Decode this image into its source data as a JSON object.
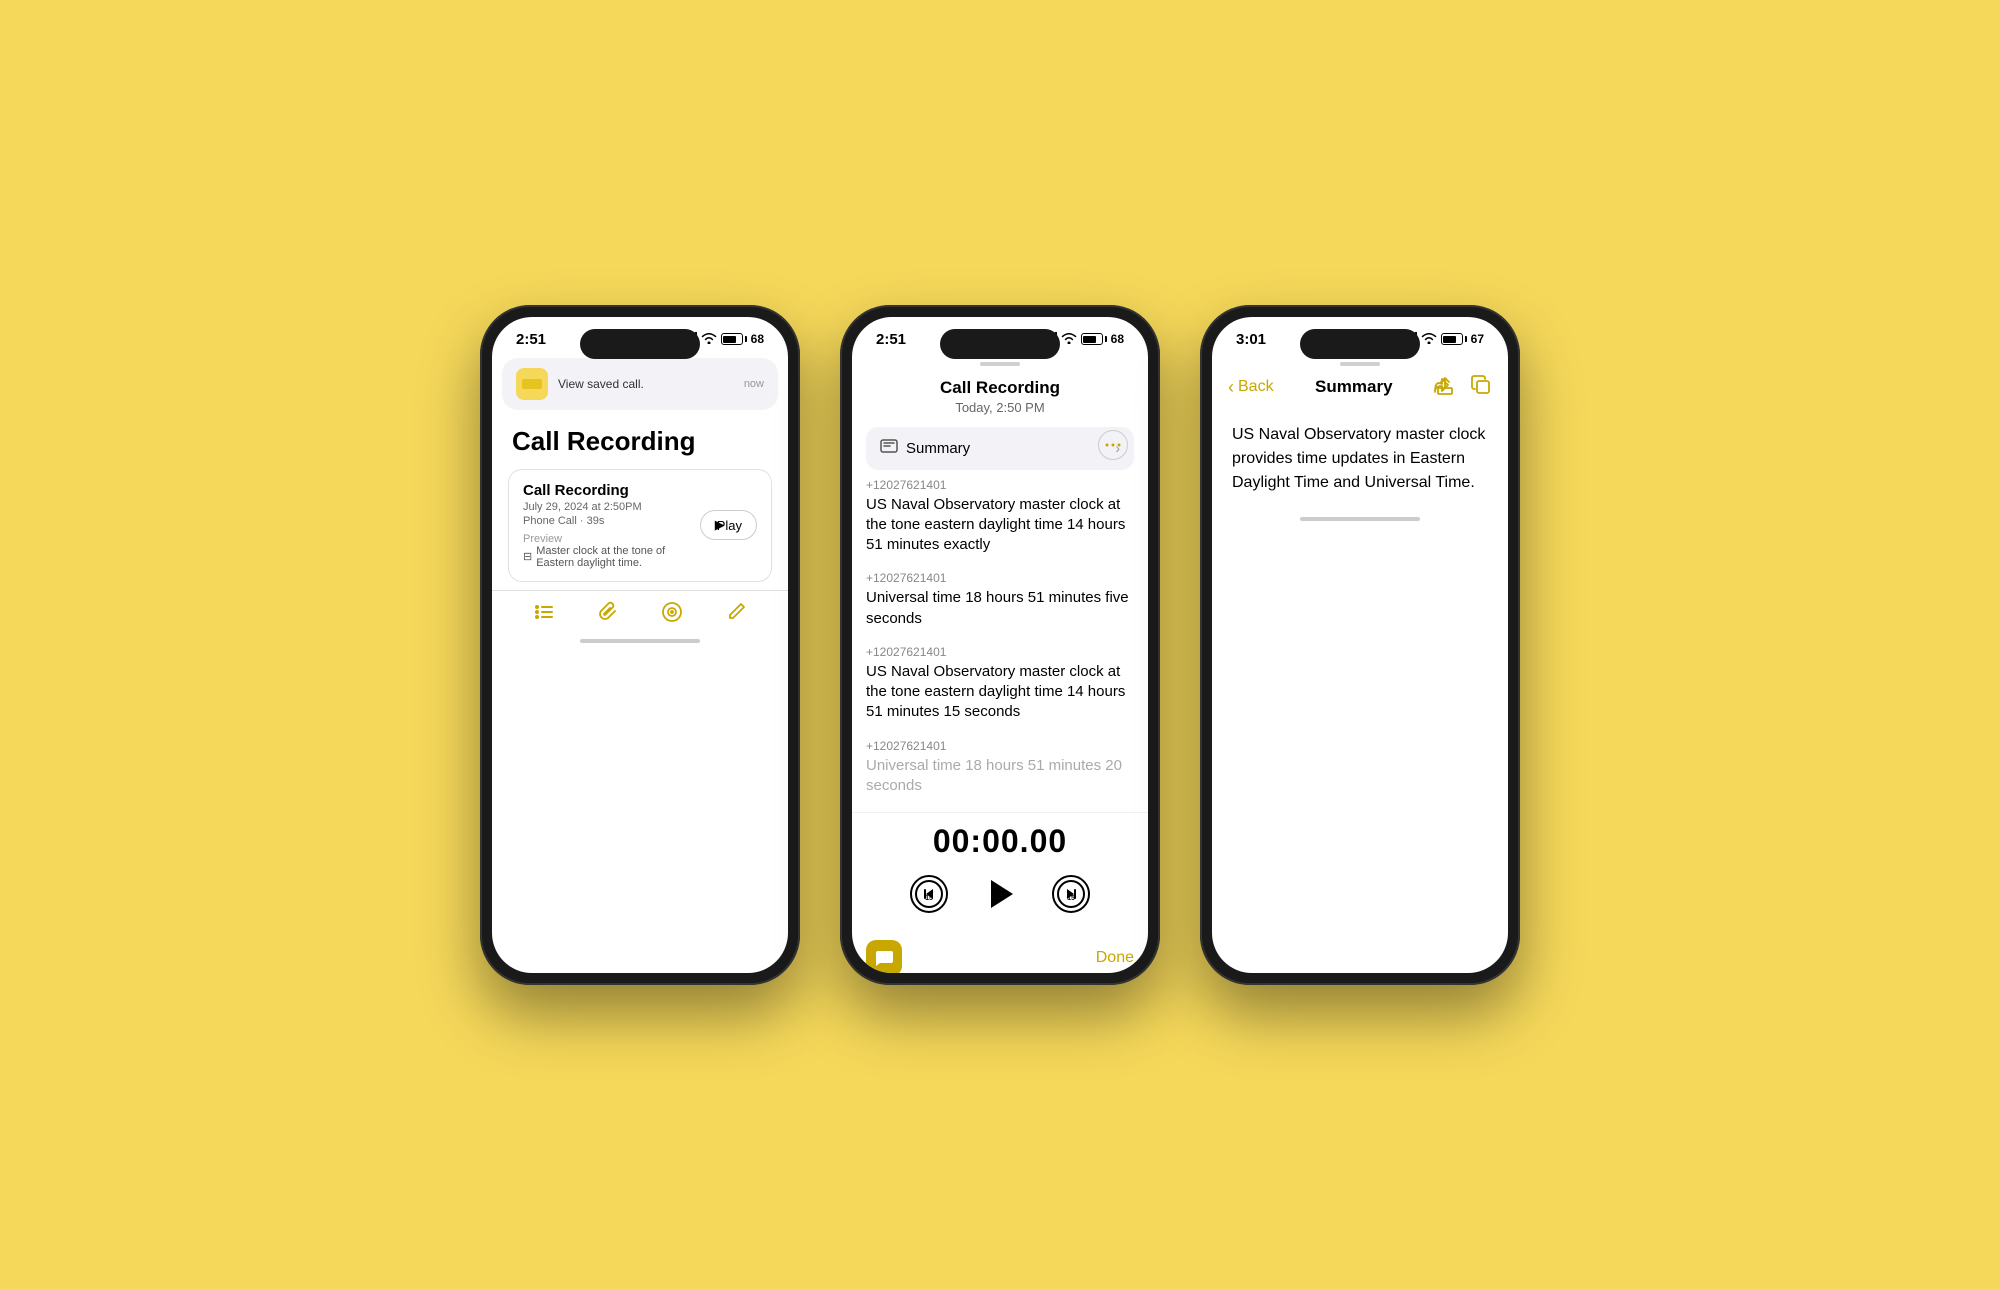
{
  "background_color": "#f5d85a",
  "accent_color": "#c8a800",
  "phone1": {
    "status_time": "2:51",
    "status_mute": "🔔",
    "signal": "●●●",
    "wifi": "wifi",
    "battery": "68",
    "notification": {
      "text": "View saved call.",
      "time": "now"
    },
    "page_title": "Call Recording",
    "card": {
      "title": "Call Recording",
      "date": "July 29, 2024 at 2:50PM",
      "type": "Phone Call · 39s",
      "preview_label": "Preview",
      "preview_text": "Master clock at the tone of Eastern daylight time.",
      "play_label": "▶ Play"
    },
    "tabs": [
      "list",
      "paperclip",
      "target",
      "edit"
    ]
  },
  "phone2": {
    "status_time": "2:51",
    "battery": "68",
    "header": {
      "title": "Call Recording",
      "date": "Today, 2:50 PM"
    },
    "summary_label": "Summary",
    "transcript": [
      {
        "number": "+12027621401",
        "text": "US Naval Observatory master clock at the tone eastern daylight time 14 hours 51 minutes exactly"
      },
      {
        "number": "+12027621401",
        "text": "Universal time 18 hours 51 minutes five seconds"
      },
      {
        "number": "+12027621401",
        "text": "US Naval Observatory master clock at the tone eastern daylight time 14 hours 51 minutes 15 seconds"
      },
      {
        "number": "+12027621401",
        "text": "Universal time 18 hours 51 minutes 20 seconds",
        "faded": true
      }
    ],
    "time_display": "00:00.00",
    "done_label": "Done"
  },
  "phone3": {
    "status_time": "3:01",
    "battery": "67",
    "nav": {
      "back_label": "Back",
      "title": "Summary"
    },
    "summary_text": "US Naval Observatory master clock provides time updates in Eastern Daylight Time and Universal Time."
  }
}
